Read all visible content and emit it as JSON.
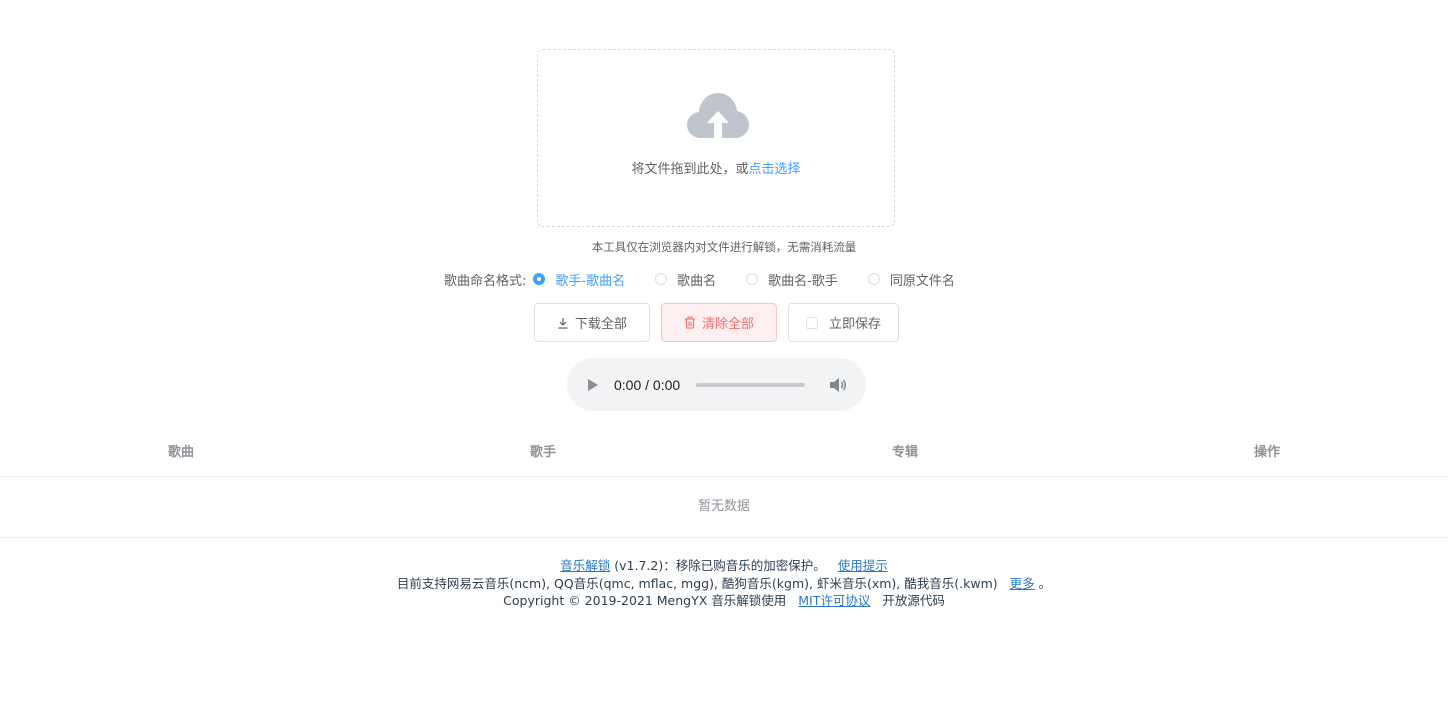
{
  "upload": {
    "drag_text": "将文件拖到此处，或",
    "pick_text": "点击选择",
    "tip": "本工具仅在浏览器内对文件进行解锁，无需消耗流量"
  },
  "format": {
    "label": "歌曲命名格式:",
    "options": [
      "歌手-歌曲名",
      "歌曲名",
      "歌曲名-歌手",
      "同原文件名"
    ],
    "selected": "歌手-歌曲名"
  },
  "buttons": {
    "download_all": "下载全部",
    "clear_all": "清除全部",
    "save_now": "立即保存"
  },
  "player": {
    "time": "0:00 / 0:00"
  },
  "table": {
    "columns": [
      "歌曲",
      "歌手",
      "专辑",
      "操作"
    ],
    "empty_text": "暂无数据"
  },
  "footer": {
    "line1": {
      "app_link": "音乐解锁",
      "version_text": "(v1.7.2)：移除已购音乐的加密保护。",
      "tips_link": "使用提示"
    },
    "line2": {
      "text": "目前支持网易云音乐(ncm), QQ音乐(qmc, mflac, mgg), 酷狗音乐(kgm), 虾米音乐(xm), 酷我音乐(.kwm)",
      "more_link": "更多",
      "end": "。"
    },
    "line3": {
      "prefix": "Copyright © 2019-2021 MengYX 音乐解锁使用",
      "license_link": "MIT许可协议",
      "suffix": "开放源代码"
    }
  },
  "colors": {
    "primary": "#409eff",
    "danger": "#f56c6c",
    "link": "#2a77c9"
  }
}
